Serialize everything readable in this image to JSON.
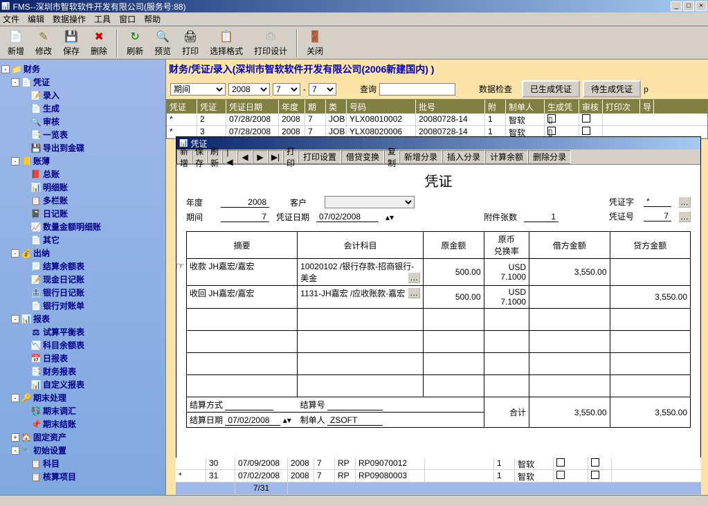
{
  "window": {
    "title": "FMS--深圳市智软软件开发有限公司(服务号:88)"
  },
  "menubar": [
    "文件",
    "编辑",
    "数据操作",
    "工具",
    "窗口",
    "帮助"
  ],
  "toolbar": [
    {
      "icon": "📄",
      "label": "新增",
      "color": "#008000"
    },
    {
      "icon": "✎",
      "label": "修改",
      "color": "#808000"
    },
    {
      "icon": "💾",
      "label": "保存",
      "color": "#808080"
    },
    {
      "icon": "✖",
      "label": "删除",
      "color": "#cc0000"
    },
    {
      "sep": true
    },
    {
      "icon": "↻",
      "label": "刷新",
      "color": "#008000"
    },
    {
      "icon": "🔍",
      "label": "预览",
      "color": "#000"
    },
    {
      "icon": "🖨",
      "label": "打印",
      "color": "#000"
    },
    {
      "icon": "📋",
      "label": "选择格式",
      "color": "#008080"
    },
    {
      "icon": "⎙",
      "label": "打印设计",
      "color": "#a0a0a0"
    },
    {
      "sep": true
    },
    {
      "icon": "🚪",
      "label": "关闭",
      "color": "#808000"
    }
  ],
  "tree": [
    {
      "label": "财务",
      "expand": "-",
      "icon": "📁",
      "children": [
        {
          "label": "凭证",
          "expand": "-",
          "icon": "📄",
          "children": [
            {
              "label": "录入",
              "icon": "📝"
            },
            {
              "label": "生成",
              "icon": "📄"
            },
            {
              "label": "审核",
              "icon": "🔍"
            },
            {
              "label": "一览表",
              "icon": "📑"
            },
            {
              "label": "导出到金碟",
              "icon": "💾"
            }
          ]
        },
        {
          "label": "账薄",
          "expand": "-",
          "icon": "📒",
          "children": [
            {
              "label": "总账",
              "icon": "📕"
            },
            {
              "label": "明细账",
              "icon": "📊"
            },
            {
              "label": "多栏账",
              "icon": "📋"
            },
            {
              "label": "日记账",
              "icon": "📓"
            },
            {
              "label": "数量金额明细账",
              "icon": "📈"
            },
            {
              "label": "其它",
              "icon": "📄"
            }
          ]
        },
        {
          "label": "出纳",
          "expand": "-",
          "icon": "💰",
          "children": [
            {
              "label": "结算余额表",
              "icon": "📃"
            },
            {
              "label": "现金日记账",
              "icon": "📝"
            },
            {
              "label": "银行日记账",
              "icon": "🏦"
            },
            {
              "label": "银行对账单",
              "icon": "📄"
            }
          ]
        },
        {
          "label": "报表",
          "expand": "-",
          "icon": "📊",
          "children": [
            {
              "label": "试算平衡表",
              "icon": "⚖"
            },
            {
              "label": "科目余额表",
              "icon": "📉"
            },
            {
              "label": "日报表",
              "icon": "📅"
            },
            {
              "label": "财务报表",
              "icon": "📑"
            },
            {
              "label": "自定义报表",
              "icon": "📊"
            }
          ]
        },
        {
          "label": "期末处理",
          "expand": "-",
          "icon": "🔑",
          "children": [
            {
              "label": "期末调汇",
              "icon": "💱"
            },
            {
              "label": "期末结账",
              "icon": "📌"
            }
          ]
        },
        {
          "label": "固定资产",
          "expand": "+",
          "icon": "🏠"
        },
        {
          "label": "初始设置",
          "expand": "-",
          "icon": "🔧",
          "children": [
            {
              "label": "科目",
              "icon": "📋"
            },
            {
              "label": "核算项目",
              "icon": "📋"
            }
          ]
        }
      ]
    }
  ],
  "content": {
    "breadcrumb": "财务/凭证/录入(深圳市智软软件开发有限公司(2006新建国内) )",
    "filter": {
      "label1": "期间",
      "year": "2008",
      "p1": "7",
      "p2": "7",
      "search_label": "查询",
      "check_label": "数据检查",
      "btn1": "已生成凭证",
      "btn2": "待生成凭证",
      "suffix": "p"
    },
    "grid_headers": [
      "凭证字",
      "凭证号",
      "凭证日期",
      "年度",
      "期间",
      "类别",
      "号码",
      "批号",
      "附页",
      "制单人",
      "生成凭证",
      "审核",
      "打印次数",
      "导"
    ],
    "grid_rows": [
      {
        "c0": "*",
        "c1": "2",
        "c2": "07/28/2008",
        "c3": "2008",
        "c4": "7",
        "c5": "JOB",
        "c6": "YLX08010002",
        "c7": "20080728-14",
        "c8": "1",
        "c9": "智软"
      },
      {
        "c0": "*",
        "c1": "3",
        "c2": "07/28/2008",
        "c3": "2008",
        "c4": "7",
        "c5": "JOB",
        "c6": "YLX08020006",
        "c7": "20080728-14",
        "c8": "1",
        "c9": "智软"
      }
    ],
    "bottom_rows": [
      {
        "c0": "",
        "c1": "30",
        "c2": "07/09/2008",
        "c3": "2008",
        "c4": "7",
        "c5": "RP",
        "c6": "RP09070012",
        "c7": "",
        "c8": "1",
        "c9": "智软"
      },
      {
        "c0": "*",
        "c1": "31",
        "c2": "07/02/2008",
        "c3": "2008",
        "c4": "7",
        "c5": "RP",
        "c6": "RP09080003",
        "c7": "",
        "c8": "1",
        "c9": "智软"
      }
    ],
    "footer_page": "7/31"
  },
  "voucher": {
    "window_title": "凭证",
    "toolbar": [
      "新增",
      "保存",
      "刷新",
      "|◀",
      "◀",
      "▶",
      "▶|",
      "打印",
      "打印设置",
      "借贷变换",
      "复制",
      "新增分录",
      "插入分录",
      "计算余额",
      "删除分录"
    ],
    "title": "凭证",
    "year_label": "年度",
    "year": "2008",
    "period_label": "期间",
    "period": "7",
    "cust_label": "客户",
    "cust": "",
    "date_label": "凭证日期",
    "date": "07/02/2008",
    "attach_label": "附件张数",
    "attach": "1",
    "word_label": "凭证字",
    "word": "*",
    "no_label": "凭证号",
    "no": "7",
    "headers": [
      "摘要",
      "会计科目",
      "原金额",
      "原币\n兑换率",
      "借方金额",
      "贷方金额"
    ],
    "rows": [
      {
        "summary": "收款 JH嘉宏/嘉宏",
        "subject": "10020102 /银行存款-招商银行-美金",
        "orig": "500.00",
        "rate": "USD\n7.1000",
        "debit": "3,550.00",
        "credit": "",
        "pointer": true
      },
      {
        "summary": "收回 JH嘉宏/嘉宏",
        "subject": "1131-JH嘉宏 /应收账款-嘉宏",
        "orig": "500.00",
        "rate": "USD\n7.1000",
        "debit": "",
        "credit": "3,550.00"
      }
    ],
    "footer": {
      "settle_type_label": "结算方式",
      "settle_type": "",
      "settle_no_label": "结算号",
      "settle_no": "",
      "settle_date_label": "结算日期",
      "settle_date": "07/02/2008",
      "maker_label": "制单人",
      "maker": "ZSOFT",
      "total_label": "合计",
      "debit": "3,550.00",
      "credit": "3,550.00"
    }
  }
}
